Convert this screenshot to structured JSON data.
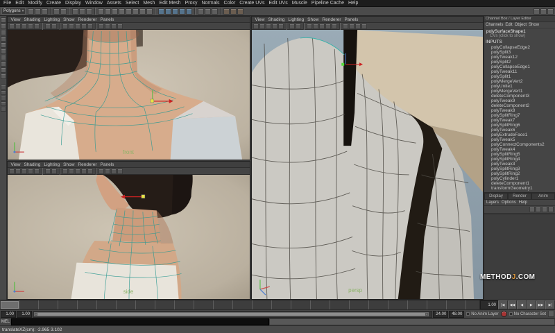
{
  "menubar": {
    "items": [
      "File",
      "Edit",
      "Modify",
      "Create",
      "Display",
      "Window",
      "Assets",
      "Select",
      "Mesh",
      "Edit Mesh",
      "Proxy",
      "Normals",
      "Color",
      "Create UVs",
      "Edit UVs",
      "Muscle",
      "Pipeline Cache",
      "Help"
    ]
  },
  "statusline": {
    "menuset": "Polygons",
    "icons": [
      "new-scene",
      "open-scene",
      "save-scene",
      "|",
      "undo",
      "redo",
      "|",
      "select-hierarchy",
      "select-object",
      "select-component",
      "|",
      "mask-handles",
      "mask-joints",
      "mask-curves",
      "mask-surfaces",
      "mask-deformations",
      "mask-dynamics",
      "mask-rendering",
      "mask-misc",
      "|",
      "snap-grid",
      "snap-curve",
      "snap-point",
      "snap-plane",
      "snap-view",
      "|",
      "input-connections",
      "output-connections",
      "construction-history",
      "|",
      "render-view",
      "ipr-render",
      "render-settings"
    ],
    "right_icons": [
      "show-attribute-editor",
      "show-tool-settings",
      "show-channel-box"
    ]
  },
  "toolbox": {
    "tools": [
      "select-tool",
      "lasso-select-tool",
      "paint-select-tool",
      "move-tool",
      "rotate-tool",
      "scale-tool",
      "universal-manipulator-tool",
      "soft-modification-tool",
      "show-manipulator-tool",
      "last-tool"
    ],
    "layouts": [
      "single-pane-layout",
      "four-view-layout",
      "persp-outliner-layout",
      "hypershade-persp-layout",
      "persp-graph-layout"
    ]
  },
  "panel_menu": [
    "View",
    "Shading",
    "Lighting",
    "Show",
    "Renderer",
    "Panels"
  ],
  "panel_toolbar": [
    "select-camera",
    "lock-camera",
    "camera-attributes",
    "bookmarks",
    "image-plane",
    "|",
    "2d-pan-zoom",
    "grease-pencil",
    "|",
    "grid-toggle",
    "film-gate",
    "resolution-gate",
    "gate-mask",
    "field-chart",
    "|",
    "wireframe-mode",
    "shaded-mode",
    "textured-mode",
    "lights-mode"
  ],
  "viewports": {
    "front": {
      "label": "front"
    },
    "side": {
      "label": "side"
    },
    "persp": {
      "label": "persp"
    }
  },
  "channel_box": {
    "header": "Channel Box / Layer Editor",
    "menu": [
      "Channels",
      "Edit",
      "Object",
      "Show"
    ],
    "object_name": "polySurfaceShape1",
    "cvs_label": "CVs (click to show)",
    "inputs_label": "INPUTS",
    "inputs": [
      "polyCollapseEdge2",
      "polySplit3",
      "polyTweak12",
      "polySplit2",
      "polyCollapseEdge1",
      "polyTweak11",
      "polySplit1",
      "polyMergeVert2",
      "polyUnite1",
      "polyMergeVert1",
      "deleteComponent3",
      "polyTweak9",
      "deleteComponent2",
      "polyTweak8",
      "polySplitRing7",
      "polyTweak7",
      "polySplitRing6",
      "polyTweak6",
      "polyExtrudeFace1",
      "polyTweak5",
      "polyConnectComponents2",
      "polyTweak4",
      "polySplitRing5",
      "polySplitRing4",
      "polyTweak3",
      "polySplitRing3",
      "polySplitRing2",
      "polyCylinder1",
      "deleteComponent1",
      "transformGeometry1"
    ]
  },
  "layer_editor": {
    "tabs": [
      "Display",
      "Render",
      "Anim"
    ],
    "menu": [
      "Layers",
      "Options",
      "Help"
    ],
    "buttons": [
      "layer-up",
      "layer-down",
      "new-empty-layer",
      "new-layer-from-selected"
    ]
  },
  "timeline": {
    "current_time": "1.00",
    "range_start": "1.00",
    "playback_start": "1.00",
    "playback_end": "24.00",
    "range_end": "48.00",
    "anim_layer_label": "No Anim Layer",
    "character_set_label": "No Character Set",
    "transport": [
      "|◀",
      "◀◀",
      "◀",
      "▶",
      "▶▶",
      "▶|"
    ]
  },
  "command_line": {
    "label": "MEL"
  },
  "help_line": {
    "text": "translateXZ(cm): -2.965 3.102"
  },
  "watermark": {
    "method": "METHOD",
    "j": "J",
    "com": ".COM"
  },
  "colors": {
    "wireframe_teal": "#2f9a92",
    "selection_green": "#52da38",
    "axis_x_red": "#cc4444",
    "axis_y_green": "#55bb44",
    "axis_z_blue": "#4f7fd0",
    "viewport_label_green": "#8cb368",
    "watermark_j_orange": "#e39a3b"
  }
}
